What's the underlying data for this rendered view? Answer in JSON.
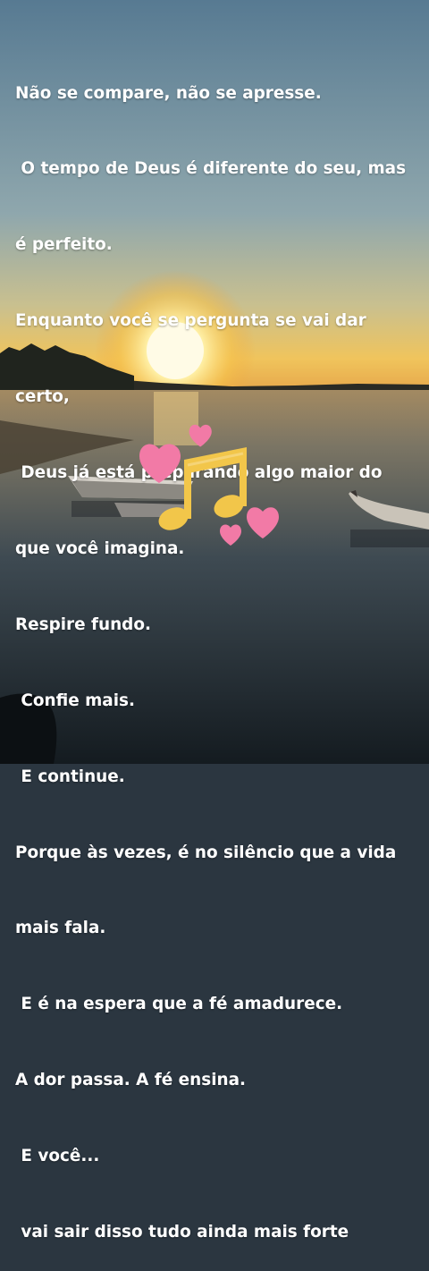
{
  "caption": {
    "lines": [
      "Não se compare, não se apresse.",
      " O tempo de Deus é diferente do seu, mas",
      "é perfeito.",
      "Enquanto você se pergunta se vai dar",
      "certo,",
      " Deus já está preparando algo maior do",
      "que você imagina.",
      "Respire fundo.",
      " Confie mais.",
      " E continue.",
      "Porque às vezes, é no silêncio que a vida",
      "mais fala.",
      " E é na espera que a fé amadurece.",
      "A dor passa. A fé ensina.",
      " E você...",
      " vai sair disso tudo ainda mais forte"
    ]
  },
  "stickers": {
    "music_note_color": "#f2c64a",
    "heart_color": "#f27aa6"
  },
  "scene": {
    "sky_top": "#5e7f96",
    "horizon": "#f4c75a",
    "sun": "#fff6c8",
    "water": "#1f2a32"
  }
}
